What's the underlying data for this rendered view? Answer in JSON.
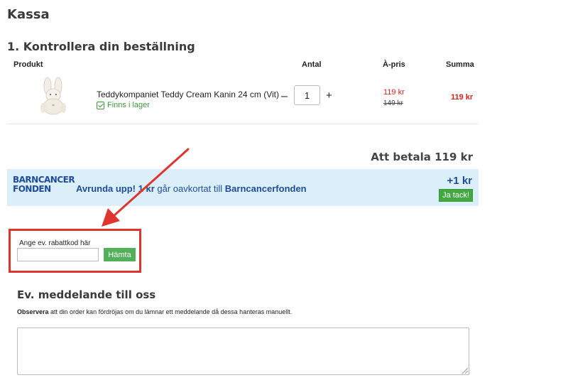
{
  "page": {
    "title": "Kassa"
  },
  "order": {
    "title": "1. Kontrollera din beställning",
    "columns": {
      "product": "Produkt",
      "qty": "Antal",
      "unit_price": "À-pris",
      "sum": "Summa"
    },
    "item": {
      "name": "Teddykompaniet Teddy Cream Kanin 24 cm (Vit)",
      "stock": "Finns i lager",
      "qty_minus": "–",
      "qty_value": "1",
      "qty_plus": "+",
      "price": "119 kr",
      "old_price": "149 kr",
      "sum": "119 kr"
    },
    "total": "Att betala 119 kr"
  },
  "charity": {
    "logo_line1": "BARNCANCER",
    "logo_line2": "FONDEN",
    "text_bold": "Avrunda upp! 1 kr",
    "text_mid": " går oavkortat till ",
    "text_org": "Barncancerfonden",
    "amount": "+1 kr",
    "button": "Ja tack!"
  },
  "coupon": {
    "label": "Ange ev. rabattkod här",
    "value": "",
    "button": "Hämta"
  },
  "message": {
    "title": "Ev. meddelande till oss",
    "note_bold": "Observera",
    "note_text": " att din order kan fördröjas om du lämnar ett meddelande då dessa hanteras manuellt.",
    "value": ""
  },
  "colors": {
    "accent_red": "#d2231b",
    "green": "#43a843",
    "charity_blue": "#1f4c9a",
    "charity_bg": "#dbeffb",
    "annotation_red": "#e0352c"
  }
}
